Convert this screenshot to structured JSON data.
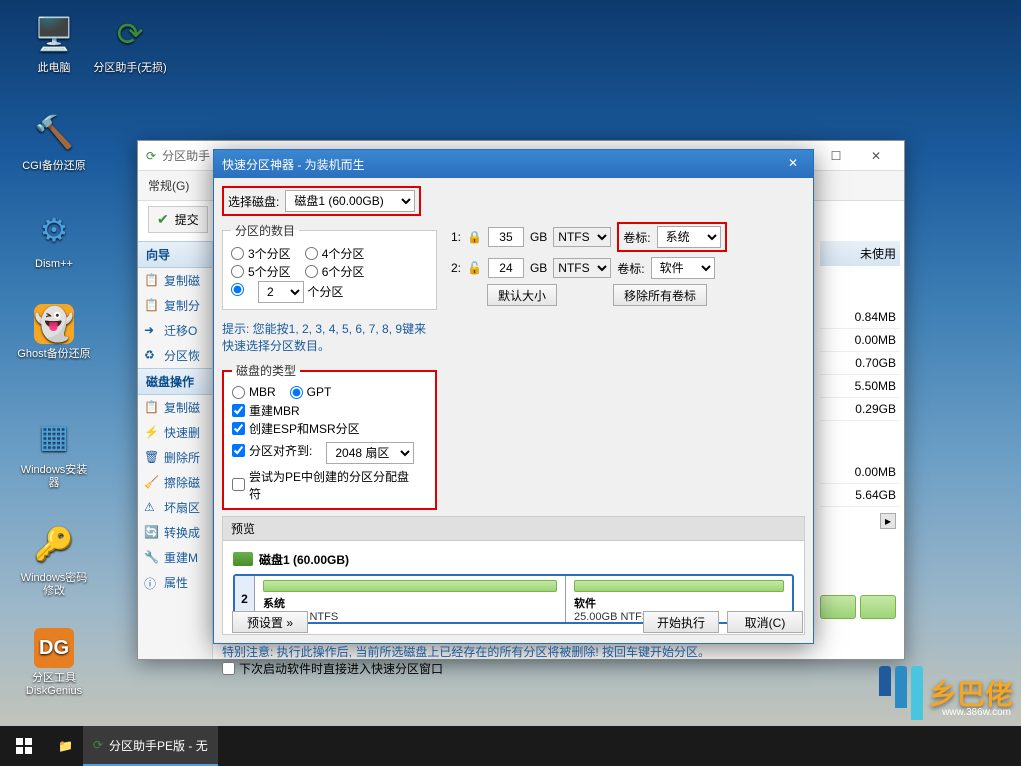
{
  "desktop": {
    "icons": [
      {
        "label": "此电脑",
        "glyph": "🖥️"
      },
      {
        "label": "分区助手(无损)",
        "glyph": "🔄"
      },
      {
        "label": "CGI备份还原",
        "glyph": "🔨"
      },
      {
        "label": "Dism++",
        "glyph": "⚙️"
      },
      {
        "label": "Ghost备份还原",
        "glyph": "👻"
      },
      {
        "label": "Windows安装器",
        "glyph": "📦"
      },
      {
        "label": "Windows密码修改",
        "glyph": "🔑"
      },
      {
        "label": "分区工具DiskGenius",
        "glyph": "💾"
      }
    ]
  },
  "mainwin": {
    "title": "分区助手",
    "menu": {
      "general": "常规(G)"
    },
    "apply": "提交",
    "sidebar": {
      "hdr1": "向导",
      "items1": [
        "复制磁",
        "复制分",
        "迁移O",
        "分区恢"
      ],
      "hdr2": "磁盘操作",
      "items2": [
        "复制磁",
        "快速删",
        "删除所",
        "擦除磁",
        "坏扇区",
        "转换成",
        "重建M",
        "属性"
      ]
    },
    "right": {
      "hdr": "未使用",
      "vals": [
        "0.84MB",
        "0.00MB",
        "0.70GB",
        "5.50MB",
        "0.29GB",
        "0.00MB",
        "5.64GB"
      ]
    }
  },
  "dialog": {
    "title": "快速分区神器 - 为装机而生",
    "select_disk_lbl": "选择磁盘:",
    "select_disk_val": "磁盘1 (60.00GB)",
    "count_legend": "分区的数目",
    "r3": "3个分区",
    "r4": "4个分区",
    "r5": "5个分区",
    "r6": "6个分区",
    "custom_count": "2",
    "custom_suffix": "个分区",
    "hint": "提示: 您能按1, 2, 3, 4, 5, 6, 7, 8, 9键来快速选择分区数目。",
    "type_legend": "磁盘的类型",
    "mbr": "MBR",
    "gpt": "GPT",
    "rebuild": "重建MBR",
    "esp": "创建ESP和MSR分区",
    "align": "分区对齐到:",
    "align_val": "2048 扇区",
    "pe": "尝试为PE中创建的分区分配盘符",
    "p1_size": "35",
    "p2_size": "24",
    "gb": "GB",
    "ntfs": "NTFS",
    "vol_lbl": "卷标:",
    "vol1": "系统",
    "vol2": "软件",
    "btn_default": "默认大小",
    "btn_remove": "移除所有卷标",
    "preview_lbl": "预览",
    "disk_name": "磁盘1  (60.00GB)",
    "part_num": "2",
    "part1_name": "系统",
    "part1_size": "35.00GB NTFS",
    "part2_name": "软件",
    "part2_size": "25.00GB NTFS",
    "warn": "特别注意: 执行此操作后, 当前所选磁盘上已经存在的所有分区将被删除!  按回车键开始分区。",
    "no_auto": "下次启动软件时直接进入快速分区窗口",
    "preset": "预设置",
    "start": "开始执行",
    "cancel": "取消(C)"
  },
  "taskbar": {
    "app": "分区助手PE版 - 无"
  },
  "watermark": {
    "txt": "乡巴佬",
    "url": "www.386w.com"
  }
}
